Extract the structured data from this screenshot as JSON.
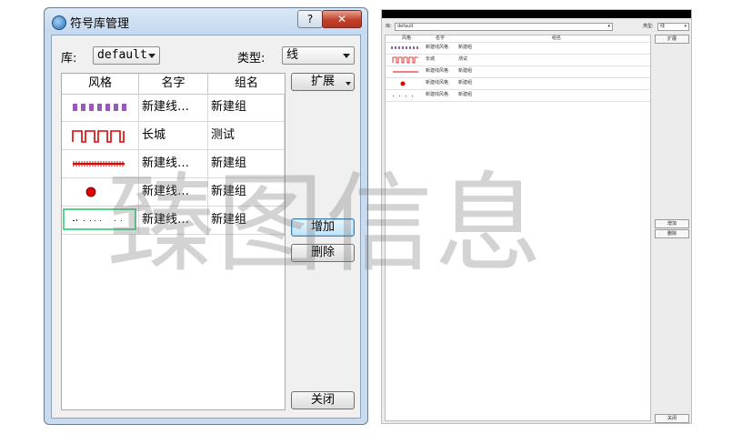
{
  "dialog": {
    "title": "符号库管理",
    "help_label": "?",
    "close_label": "✕",
    "library_label": "库:",
    "library_value": "default",
    "type_label": "类型:",
    "type_value": "线",
    "columns": [
      "风格",
      "名字",
      "组名"
    ],
    "rows": [
      {
        "style": "dashed-purple",
        "name": "新建线…",
        "group": "新建组"
      },
      {
        "style": "square-wave-red",
        "name": "长城",
        "group": "测试"
      },
      {
        "style": "ticks-red",
        "name": "新建线…",
        "group": "新建组"
      },
      {
        "style": "red-dot",
        "name": "新建线…",
        "group": "新建组"
      },
      {
        "style": "dots-sparse",
        "name": "新建线…",
        "group": "新建组"
      }
    ],
    "buttons": {
      "expand": "扩展",
      "add": "增加",
      "delete": "删除",
      "close": "关闭"
    }
  },
  "watermark": "臻图信息",
  "preview": {
    "library_label": "库:",
    "library_value": "default",
    "type_label": "类型:",
    "type_value": "线",
    "columns": [
      "风格",
      "名字",
      "组名"
    ],
    "rows": [
      {
        "name": "新建线风格",
        "group": "新建组"
      },
      {
        "name": "长城",
        "group": "测试"
      },
      {
        "name": "新建线风格",
        "group": "新建组"
      },
      {
        "name": "新建线风格",
        "group": "新建组"
      },
      {
        "name": "新建线风格",
        "group": "新建组"
      }
    ],
    "buttons": {
      "expand": "扩展",
      "add": "增加",
      "delete": "删除",
      "close": "关闭"
    }
  },
  "colors": {
    "purple": "#9b59b6",
    "red": "#e00000",
    "pink_red": "#f08080",
    "selection": "#55d688"
  }
}
